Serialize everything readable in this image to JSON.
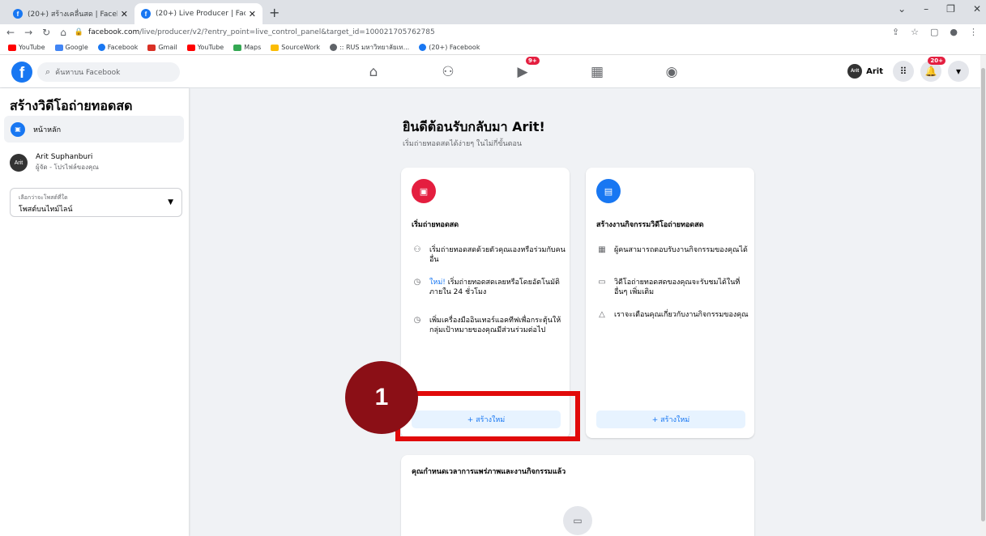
{
  "browser": {
    "tabs": [
      {
        "title": "(20+) สร้างเคลื่นสด | Facebook",
        "active": false
      },
      {
        "title": "(20+) Live Producer | Facebook",
        "active": true
      }
    ],
    "new_tab": "+",
    "url_domain": "facebook.com",
    "url_path": "/live/producer/v2/?entry_point=live_control_panel&target_id=100021705762785",
    "bookmarks": [
      {
        "label": "YouTube",
        "color": "#ff0000"
      },
      {
        "label": "Google",
        "color": "#4285f4"
      },
      {
        "label": "Facebook",
        "color": "#1877f2"
      },
      {
        "label": "Gmail",
        "color": "#d93025"
      },
      {
        "label": "YouTube",
        "color": "#ff0000"
      },
      {
        "label": "Maps",
        "color": "#34a853"
      },
      {
        "label": "SourceWork",
        "color": "#fbbc04"
      },
      {
        "label": ":: RUS มหาวิทยาลัยเท...",
        "color": "#5f6368"
      },
      {
        "label": "(20+) Facebook",
        "color": "#1877f2"
      }
    ]
  },
  "fb": {
    "search_placeholder": "ค้นหาบน Facebook",
    "video_badge": "9+",
    "notif_badge": "20+",
    "profile_name": "Arit",
    "avatar_text": "Arit"
  },
  "sidebar": {
    "title": "สร้างวิดีโอถ่ายทอดสด",
    "home_label": "หน้าหลัก",
    "user_name": "Arit Suphanburi",
    "user_sub": "ผู้จัด - โปรไฟล์ของคุณ",
    "select_label": "เลือกว่าจะโพสต์ที่ใด",
    "select_value": "โพสต์บนไทม์ไลน์"
  },
  "main": {
    "heading": "ยินดีต้อนรับกลับมา Arit!",
    "subheading": "เริ่มถ่ายทอดสดได้ง่ายๆ ในไม่กี่ขั้นตอน",
    "card1": {
      "title": "เริ่มถ่ายทอดสด",
      "f1": "เริ่มถ่ายทอดสดด้วยตัวคุณเองหรือร่วมกับคนอื่น",
      "f2_new": "ใหม่!",
      "f2": " เริ่มถ่ายทอดสดเลยหรือโดยอัตโนมัติภายใน 24 ชั่วโมง",
      "f3": "เพิ่มเครื่องมืออินเทอร์แอคทีฟเพื่อกระตุ้นให้กลุ่มเป้าหมายของคุณมีส่วนร่วมต่อไป",
      "button": "+ สร้างใหม่",
      "icon_color": "#e41e3f"
    },
    "card2": {
      "title": "สร้างงานกิจกรรมวิดีโอถ่ายทอดสด",
      "f1": "ผู้คนสามารถตอบรับงานกิจกรรมของคุณได้",
      "f2": "วิดีโอถ่ายทอดสดของคุณจะรับชมได้ในที่อื่นๆ เพิ่มเติม",
      "f3": "เราจะเตือนคุณเกี่ยวกับงานกิจกรรมของคุณ",
      "button": "+ สร้างใหม่",
      "icon_color": "#1877f2"
    },
    "card3": {
      "title": "คุณกำหนดเวลาการแพร่ภาพและงานกิจกรรมแล้ว"
    }
  },
  "annotation": {
    "number": "1",
    "circle_color": "#8b0f16",
    "box_color": "#e10a0a"
  }
}
